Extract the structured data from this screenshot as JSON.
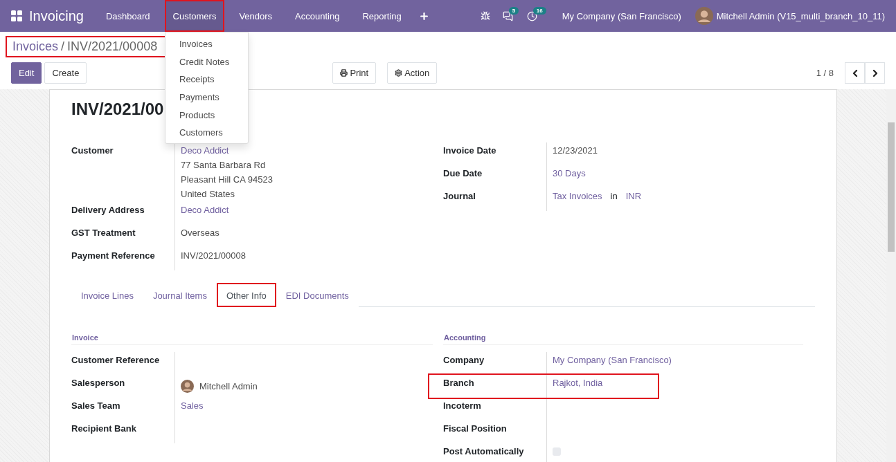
{
  "navbar": {
    "app_title": "Invoicing",
    "menu": [
      {
        "label": "Dashboard",
        "selected": false,
        "highlighted": false
      },
      {
        "label": "Customers",
        "selected": true,
        "highlighted": true
      },
      {
        "label": "Vendors",
        "selected": false,
        "highlighted": false
      },
      {
        "label": "Accounting",
        "selected": false,
        "highlighted": false
      },
      {
        "label": "Reporting",
        "selected": false,
        "highlighted": false
      }
    ],
    "notifications": [
      {
        "kind": "chat",
        "count": "5"
      },
      {
        "kind": "activity",
        "count": "16"
      }
    ],
    "company": "My Company (San Francisco)",
    "user": "Mitchell Admin (V15_multi_branch_10_11)"
  },
  "dropdown": {
    "items": [
      "Invoices",
      "Credit Notes",
      "Receipts",
      "Payments",
      "Products",
      "Customers"
    ]
  },
  "breadcrumb": {
    "highlighted": true,
    "parent": "Invoices",
    "separator": "/",
    "current": "INV/2021/00008"
  },
  "buttons": [
    {
      "label": "Edit",
      "kind": "primary"
    },
    {
      "label": "Create",
      "kind": "secondary"
    }
  ],
  "actions": [
    {
      "label": "Print",
      "kind": "print"
    },
    {
      "label": "Action",
      "kind": "gear"
    }
  ],
  "pager": "1 / 8",
  "sheet": {
    "title": "INV/2021/00",
    "left_fields": [
      {
        "label": "Customer",
        "kind": "address",
        "value": "Deco Addict",
        "lines": [
          "77 Santa Barbara Rd",
          "Pleasant Hill CA 94523",
          "United States"
        ]
      },
      {
        "label": "Delivery Address",
        "kind": "link",
        "value": "Deco Addict"
      },
      {
        "label": "GST Treatment",
        "kind": "text",
        "value": "Overseas"
      },
      {
        "label": "Payment Reference",
        "kind": "text",
        "value": "INV/2021/00008"
      }
    ],
    "right_fields": [
      {
        "label": "Invoice Date",
        "kind": "text",
        "value": "12/23/2021"
      },
      {
        "label": "Due Date",
        "kind": "link",
        "value": "30 Days"
      },
      {
        "label": "Journal",
        "kind": "parts",
        "parts": [
          {
            "text": "Tax Invoices",
            "link": true
          },
          {
            "text": "in",
            "link": false
          },
          {
            "text": "INR",
            "link": true
          }
        ]
      }
    ],
    "tabs": [
      {
        "label": "Invoice Lines",
        "selected": false,
        "highlighted": false
      },
      {
        "label": "Journal Items",
        "selected": false,
        "highlighted": false
      },
      {
        "label": "Other Info",
        "selected": true,
        "highlighted": true
      },
      {
        "label": "EDI Documents",
        "selected": false,
        "highlighted": false
      }
    ],
    "sections": [
      {
        "title": "Invoice",
        "fields": [
          {
            "label": "Customer Reference",
            "kind": "empty",
            "highlighted": false
          },
          {
            "label": "Salesperson",
            "kind": "avatar",
            "value": "Mitchell Admin",
            "highlighted": false
          },
          {
            "label": "Sales Team",
            "kind": "link",
            "value": "Sales",
            "highlighted": false
          },
          {
            "label": "Recipient Bank",
            "kind": "empty",
            "highlighted": false
          }
        ]
      },
      {
        "title": "Accounting",
        "fields": [
          {
            "label": "Company",
            "kind": "link",
            "value": "My Company (San Francisco)",
            "highlighted": false
          },
          {
            "label": "Branch",
            "kind": "link",
            "value": "Rajkot, India",
            "highlighted": true
          },
          {
            "label": "Incoterm",
            "kind": "empty",
            "highlighted": false
          },
          {
            "label": "Fiscal Position",
            "kind": "empty",
            "highlighted": false
          },
          {
            "label": "Post Automatically",
            "kind": "checkbox",
            "checked": false,
            "highlighted": false
          }
        ]
      }
    ]
  }
}
